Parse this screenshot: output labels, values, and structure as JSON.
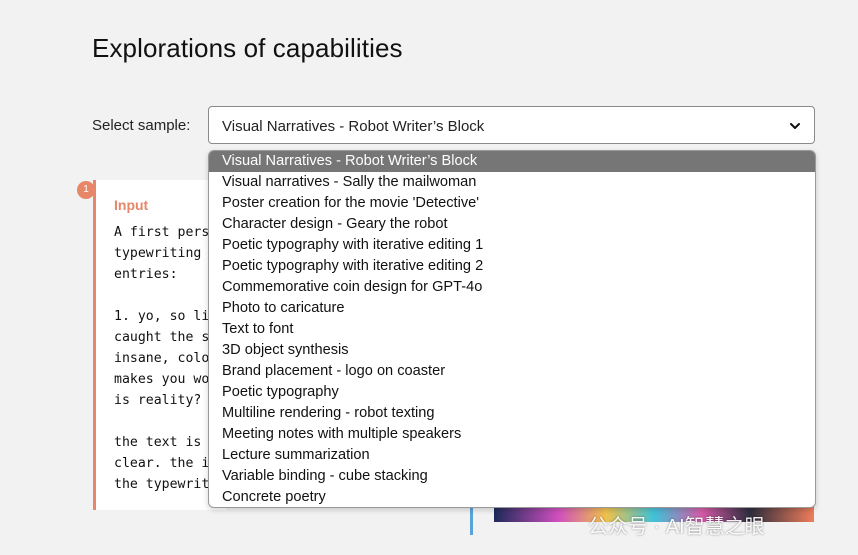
{
  "page": {
    "title": "Explorations of capabilities"
  },
  "select": {
    "label": "Select sample:",
    "value": "Visual Narratives - Robot Writer’s Block",
    "caret_icon": "chevron-down-icon",
    "options": [
      "Visual Narratives - Robot Writer’s Block",
      "Visual narratives - Sally the mailwoman",
      "Poster creation for the movie 'Detective'",
      "Character design - Geary the robot",
      "Poetic typography with iterative editing 1",
      "Poetic typography with iterative editing 2",
      "Commemorative coin design for GPT-4o",
      "Photo to caricature",
      "Text to font",
      "3D object synthesis",
      "Brand placement - logo on coaster",
      "Poetic typography",
      "Multiline rendering - robot texting",
      "Meeting notes with multiple speakers",
      "Lecture summarization",
      "Variable binding - cube stacking",
      "Concrete poetry"
    ],
    "selected_index": 0
  },
  "card": {
    "badge": "1",
    "heading": "Input",
    "body_lines": [
      "A first pers",
      "typewriting",
      "entries:",
      "",
      "1. yo, so li",
      "caught the s",
      "insane, colo",
      "makes you wo",
      "is reality?",
      "",
      "the text is",
      "clear. the i",
      "the typewrit"
    ]
  },
  "watermark": "公众号 · AI智慧之眼",
  "colors": {
    "accent_orange": "#e8866a",
    "selected_option_bg": "#767676",
    "blue_rule": "#5aa3d8"
  }
}
